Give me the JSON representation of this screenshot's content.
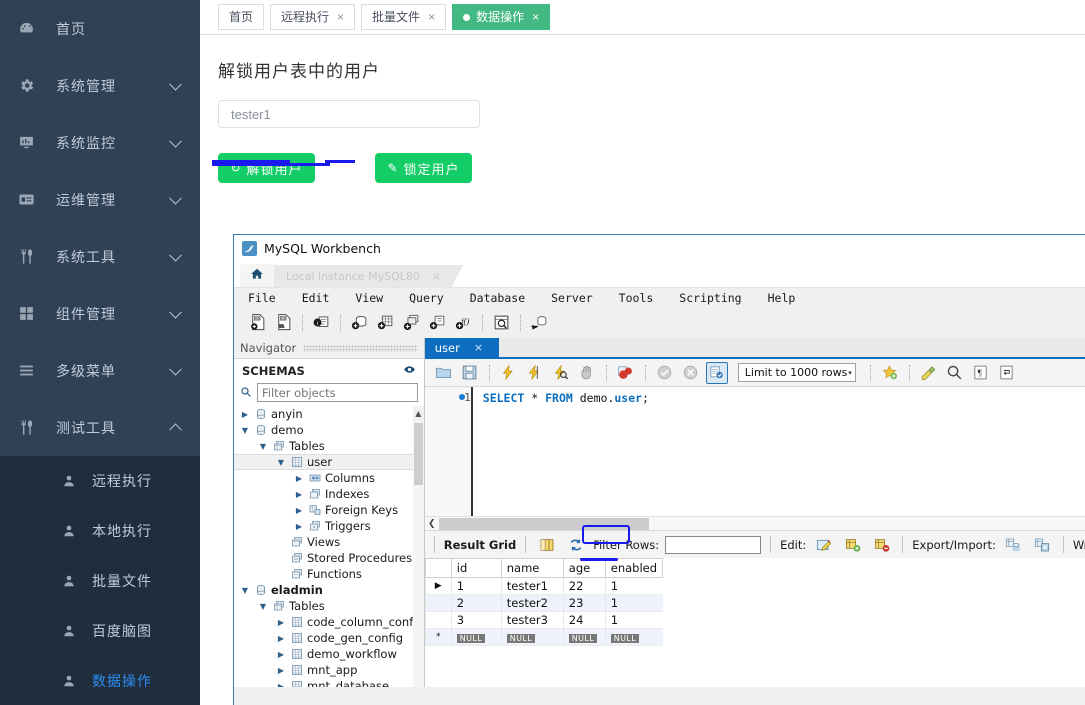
{
  "sidebar": {
    "items": [
      {
        "label": "首页",
        "icon": "dashboard-icon",
        "expandable": false
      },
      {
        "label": "系统管理",
        "icon": "gear-icon",
        "expandable": true
      },
      {
        "label": "系统监控",
        "icon": "monitor-icon",
        "expandable": true
      },
      {
        "label": "运维管理",
        "icon": "server-card-icon",
        "expandable": true
      },
      {
        "label": "系统工具",
        "icon": "tools-icon",
        "expandable": true
      },
      {
        "label": "组件管理",
        "icon": "grid-icon",
        "expandable": true
      },
      {
        "label": "多级菜单",
        "icon": "menu-lines-icon",
        "expandable": true
      },
      {
        "label": "测试工具",
        "icon": "tools-icon",
        "expandable": true,
        "expanded": true
      }
    ],
    "submenu": [
      {
        "label": "远程执行",
        "icon": "user-icon",
        "active": false
      },
      {
        "label": "本地执行",
        "icon": "user-icon",
        "active": false
      },
      {
        "label": "批量文件",
        "icon": "user-icon",
        "active": false
      },
      {
        "label": "百度脑图",
        "icon": "user-icon",
        "active": false
      },
      {
        "label": "数据操作",
        "icon": "user-icon",
        "active": true
      }
    ],
    "bg_color": "#304156",
    "submenu_bg_color": "#1f2d3d",
    "active_text_color": "#2d8cf0"
  },
  "tabs": [
    {
      "label": "首页",
      "closable": false,
      "active": false
    },
    {
      "label": "远程执行",
      "closable": true,
      "active": false
    },
    {
      "label": "批量文件",
      "closable": true,
      "active": false
    },
    {
      "label": "数据操作",
      "closable": true,
      "active": true
    }
  ],
  "tab_close_glyph": "×",
  "panel": {
    "title": "解锁用户表中的用户",
    "input_value": "tester1",
    "input_placeholder": "tester1",
    "buttons": [
      {
        "label": "解锁用户",
        "icon": "refresh-icon",
        "glyph": "↻",
        "color": "#13ce66"
      },
      {
        "label": "锁定用户",
        "icon": "pencil-icon",
        "glyph": "✎",
        "color": "#13ce66"
      }
    ]
  },
  "workbench": {
    "window_title": "MySQL Workbench",
    "home_tab_icon": "home-icon",
    "connection_tab": {
      "label": "Local instance MySQL80",
      "close_glyph": "×"
    },
    "menus": [
      "File",
      "Edit",
      "View",
      "Query",
      "Database",
      "Server",
      "Tools",
      "Scripting",
      "Help"
    ],
    "toolbar_icons": [
      "new-sql-file-icon",
      "open-sql-file-icon",
      "sep",
      "connection-info-icon",
      "sep",
      "new-schema-icon",
      "new-table-icon",
      "new-view-icon",
      "new-procedure-icon",
      "new-function-icon",
      "sep",
      "search-table-data-icon",
      "sep",
      "reconnect-icon"
    ],
    "navigator": {
      "header": "Navigator",
      "section_title": "SCHEMAS",
      "refresh_icon": "refresh-schemas-icon",
      "filter_placeholder": "Filter objects",
      "search_icon": "search-icon",
      "tree": [
        {
          "label": "anyin",
          "depth": 0,
          "arrow": "▶",
          "icon": "schema-icon",
          "bold": false
        },
        {
          "label": "demo",
          "depth": 0,
          "arrow": "▼",
          "icon": "schema-icon",
          "bold": false
        },
        {
          "label": "Tables",
          "depth": 1,
          "arrow": "▼",
          "icon": "folder-tables-icon",
          "bold": false
        },
        {
          "label": "user",
          "depth": 2,
          "arrow": "▼",
          "icon": "table-icon",
          "bold": false,
          "selected": true
        },
        {
          "label": "Columns",
          "depth": 3,
          "arrow": "▶",
          "icon": "columns-icon",
          "bold": false
        },
        {
          "label": "Indexes",
          "depth": 3,
          "arrow": "▶",
          "icon": "indexes-icon",
          "bold": false
        },
        {
          "label": "Foreign Keys",
          "depth": 3,
          "arrow": "▶",
          "icon": "foreign-keys-icon",
          "bold": false
        },
        {
          "label": "Triggers",
          "depth": 3,
          "arrow": "▶",
          "icon": "triggers-icon",
          "bold": false
        },
        {
          "label": "Views",
          "depth": 2,
          "arrow": "",
          "icon": "folder-views-icon",
          "bold": false
        },
        {
          "label": "Stored Procedures",
          "depth": 2,
          "arrow": "",
          "icon": "folder-procedures-icon",
          "bold": false
        },
        {
          "label": "Functions",
          "depth": 2,
          "arrow": "",
          "icon": "folder-functions-icon",
          "bold": false
        },
        {
          "label": "eladmin",
          "depth": 0,
          "arrow": "▼",
          "icon": "schema-icon",
          "bold": true
        },
        {
          "label": "Tables",
          "depth": 1,
          "arrow": "▼",
          "icon": "folder-tables-icon",
          "bold": false
        },
        {
          "label": "code_column_config",
          "depth": 2,
          "arrow": "▶",
          "icon": "table-icon",
          "bold": false
        },
        {
          "label": "code_gen_config",
          "depth": 2,
          "arrow": "▶",
          "icon": "table-icon",
          "bold": false
        },
        {
          "label": "demo_workflow",
          "depth": 2,
          "arrow": "▶",
          "icon": "table-icon",
          "bold": false
        },
        {
          "label": "mnt_app",
          "depth": 2,
          "arrow": "▶",
          "icon": "table-icon",
          "bold": false
        },
        {
          "label": "mnt_database",
          "depth": 2,
          "arrow": "▶",
          "icon": "table-icon",
          "bold": false
        }
      ]
    },
    "query_tab": {
      "label": "user",
      "close_glyph": "×"
    },
    "query_toolbar": {
      "icons": [
        "open-script-icon",
        "save-script-icon",
        "sep",
        "execute-icon",
        "execute-current-icon",
        "explain-icon",
        "stop-on-error-icon",
        "sep",
        "toggle-whitespace-icon",
        "sep",
        "commit-icon",
        "rollback-icon",
        "autocommit-icon"
      ],
      "limit_label": "Limit to 1000 rows",
      "limit_carat": "▾",
      "right_icons": [
        "beautify-icon",
        "clear-icon",
        "find-icon",
        "invisible-chars-icon",
        "wrap-lines-icon"
      ]
    },
    "editor": {
      "line_number": "1",
      "sql_parts": [
        {
          "text": "SELECT",
          "type": "kw"
        },
        {
          "text": " * ",
          "type": "plain"
        },
        {
          "text": "FROM",
          "type": "kw"
        },
        {
          "text": " demo.",
          "type": "plain"
        },
        {
          "text": "user",
          "type": "ident"
        },
        {
          "text": ";",
          "type": "plain"
        }
      ],
      "sql_full": "SELECT * FROM demo.user;"
    },
    "result_toolbar": {
      "label": "Result Grid",
      "grid_icon": "result-grid-icon",
      "refresh_icon": "refresh-rows-icon",
      "filter_label": "Filter Rows:",
      "filter_value": "",
      "edit_label": "Edit:",
      "edit_icons": [
        "edit-cell-icon",
        "insert-row-icon",
        "delete-row-icon"
      ],
      "export_label": "Export/Import:",
      "export_icons": [
        "export-recordset-icon",
        "import-recordset-icon"
      ],
      "wrap_label": "Wrap Cell Cont"
    },
    "result_grid": {
      "columns": [
        "id",
        "name",
        "age",
        "enabled"
      ],
      "rows": [
        {
          "marker": "▶",
          "id": "1",
          "name": "tester1",
          "age": "22",
          "enabled": "1"
        },
        {
          "marker": "",
          "id": "2",
          "name": "tester2",
          "age": "23",
          "enabled": "1"
        },
        {
          "marker": "",
          "id": "3",
          "name": "tester3",
          "age": "24",
          "enabled": "1"
        },
        {
          "marker": "*",
          "id": "NULL",
          "name": "NULL",
          "age": "NULL",
          "enabled": "NULL"
        }
      ]
    }
  },
  "annotations": {
    "color": "#1a1aee",
    "marks": [
      "underline-under-input",
      "box-around-enabled-column",
      "underline-under-enabled-value"
    ]
  }
}
